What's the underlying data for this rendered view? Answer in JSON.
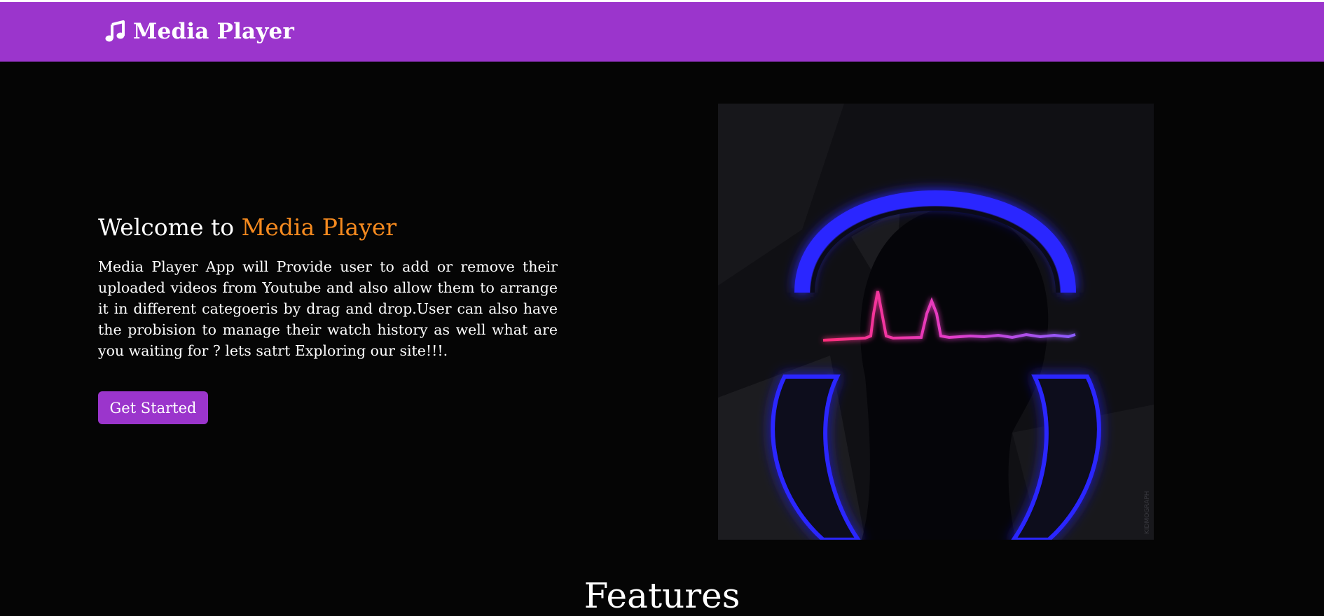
{
  "navbar": {
    "brand_icon": "music-note-icon",
    "brand_title": "Media Player",
    "background": "#9b35cc"
  },
  "hero": {
    "welcome_prefix": "Welcome to",
    "welcome_highlight": "Media Player",
    "highlight_color": "#f58a1f",
    "description": "Media Player App will Provide user to add or remove their uploaded videos from Youtube and also allow them to arrange it in different categoeris by drag and drop.User can also have the probision to manage their watch history as well what are you waiting for ? lets satrt Exploring our site!!!.",
    "cta_label": "Get Started",
    "image": {
      "description": "headphones-heartbeat-illustration",
      "watermark": "KIDMOGRAPH"
    }
  },
  "features": {
    "heading": "Features"
  }
}
